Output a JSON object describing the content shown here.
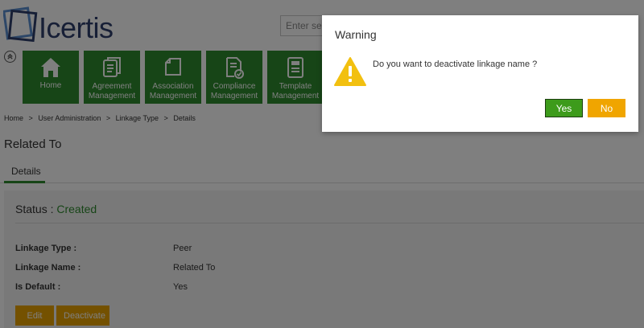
{
  "brand": {
    "name": "Icertis",
    "logo_color": "#2e3e6c"
  },
  "search": {
    "placeholder": "Enter sea"
  },
  "nav": {
    "collapse_icon": "chevron-up-circle-icon",
    "tiles": [
      {
        "label": "Home",
        "icon": "home-icon"
      },
      {
        "label": "Agreement Management",
        "line1": "Agreement",
        "line2": "Management",
        "icon": "documents-icon"
      },
      {
        "label": "Association Management",
        "line1": "Association",
        "line2": "Management",
        "icon": "copy-icon"
      },
      {
        "label": "Compliance Management",
        "line1": "Compliance",
        "line2": "Management",
        "icon": "document-check-icon"
      },
      {
        "label": "Template Management",
        "line1": "Template",
        "line2": "Management",
        "icon": "template-icon"
      }
    ],
    "tile_color": "#2e8b2e"
  },
  "breadcrumb": [
    "Home",
    ">",
    "User Administration",
    ">",
    "Linkage Type",
    ">",
    "Details"
  ],
  "page": {
    "title": "Related To",
    "tabs": [
      {
        "label": "Details",
        "active": true
      }
    ],
    "status_label": "Status : ",
    "status_value": "Created",
    "status_color": "#2e8b2e",
    "fields": [
      {
        "label": "Linkage Type :",
        "value": "Peer"
      },
      {
        "label": "Linkage Name :",
        "value": "Related To"
      },
      {
        "label": "Is Default :",
        "value": "Yes"
      }
    ],
    "actions": {
      "edit": "Edit",
      "deactivate": "Deactivate"
    },
    "action_color": "#e8a200"
  },
  "dialog": {
    "title": "Warning",
    "icon": "warning-triangle-icon",
    "message": "Do you want to deactivate linkage name ?",
    "yes_label": "Yes",
    "no_label": "No",
    "yes_color": "#3d9b1b",
    "no_color": "#f0a500"
  }
}
